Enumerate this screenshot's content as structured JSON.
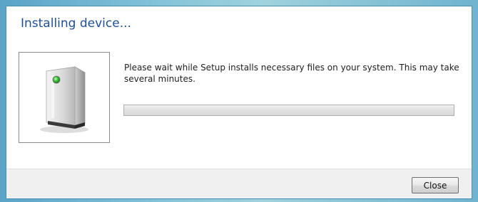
{
  "dialog": {
    "title": "Installing device...",
    "message": "Please wait while Setup installs necessary files on your system. This may take several minutes.",
    "progress": 0,
    "device_icon": "computer-tower-icon"
  },
  "footer": {
    "close_label": "Close"
  },
  "colors": {
    "title": "#1f4f94",
    "frame": "#5aa3c8",
    "progress_track": "#e1e1e1",
    "status_led": "#3cc43c"
  }
}
